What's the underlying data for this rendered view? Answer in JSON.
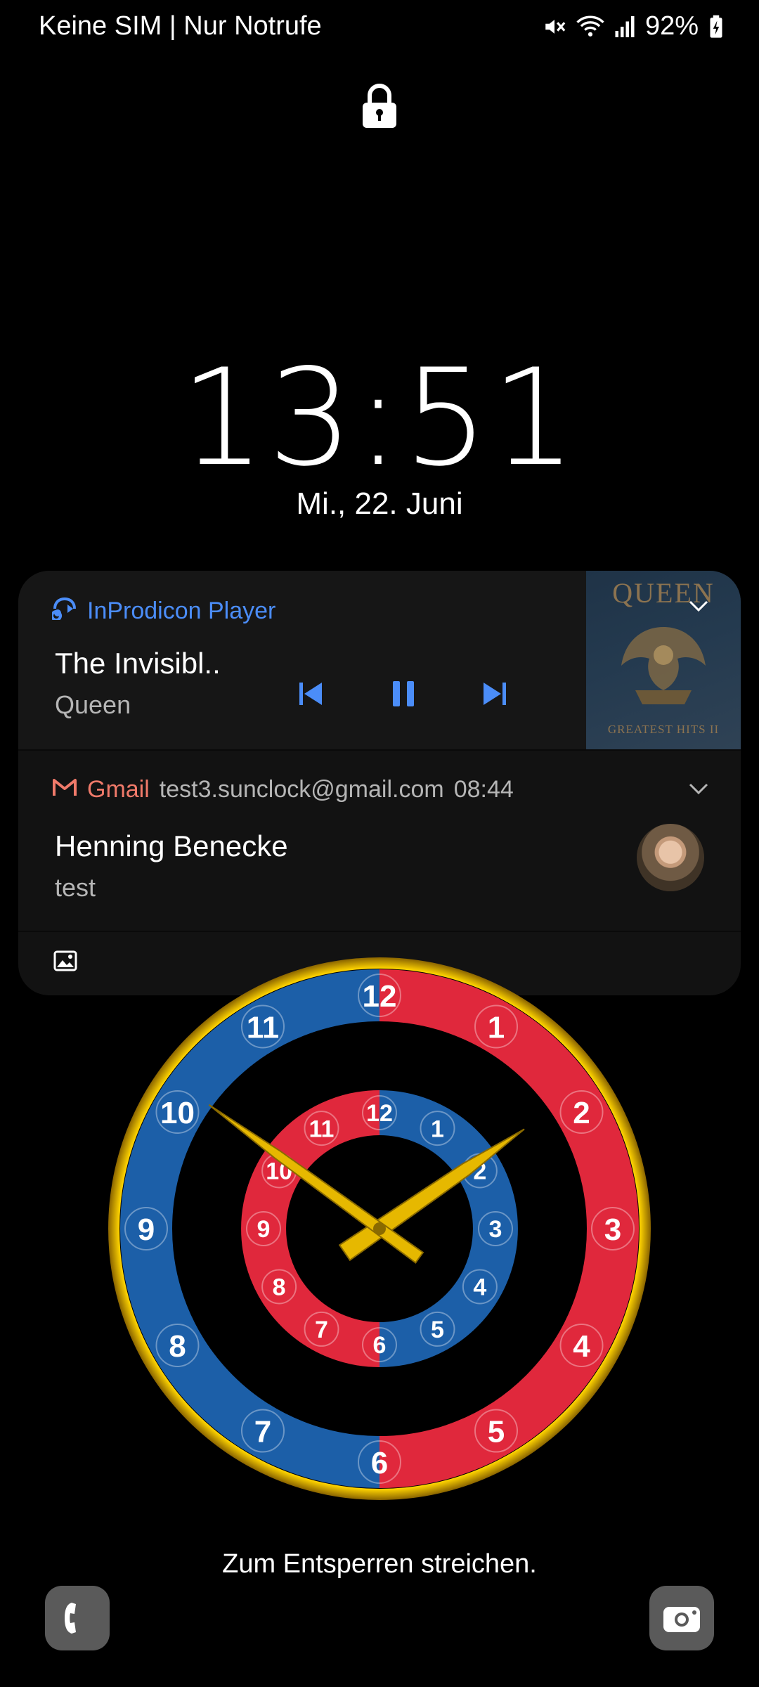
{
  "status_bar": {
    "carrier": "Keine SIM | Nur Notrufe",
    "battery": "92%",
    "icons": [
      "mute-icon",
      "wifi-icon",
      "signal-icon",
      "battery-charging-icon"
    ]
  },
  "lock": {
    "icon": "lock-icon"
  },
  "clock": {
    "time": "13:51",
    "date": "Mi., 22. Juni"
  },
  "media_notification": {
    "app_name": "InProdicon Player",
    "title": "The Invisibl..",
    "artist": "Queen",
    "album_art": {
      "title": "QUEEN",
      "subtitle": "GREATEST HITS II"
    },
    "controls": [
      "previous-icon",
      "pause-icon",
      "next-icon"
    ],
    "accent": "#4b8df8"
  },
  "gmail_notification": {
    "app_name": "Gmail",
    "account": "test3.sunclock@gmail.com",
    "time": "08:44",
    "sender": "Henning Benecke",
    "subject": "test",
    "accent": "#f07a6a"
  },
  "analog_clock": {
    "hour": 13,
    "minute": 51,
    "outer_ring_numbers": [
      "12",
      "1",
      "2",
      "3",
      "4",
      "5",
      "6",
      "7",
      "8",
      "9",
      "10",
      "11"
    ],
    "inner_ring_numbers": [
      "12",
      "1",
      "2",
      "3",
      "4",
      "5",
      "6",
      "7",
      "8",
      "9",
      "10",
      "11"
    ],
    "colors": {
      "blue": "#1c5fa8",
      "red": "#e0283c",
      "gold": "#e6b800"
    }
  },
  "unlock_hint": "Zum Entsperren streichen.",
  "shortcuts": {
    "left": "phone-icon",
    "right": "camera-icon"
  }
}
